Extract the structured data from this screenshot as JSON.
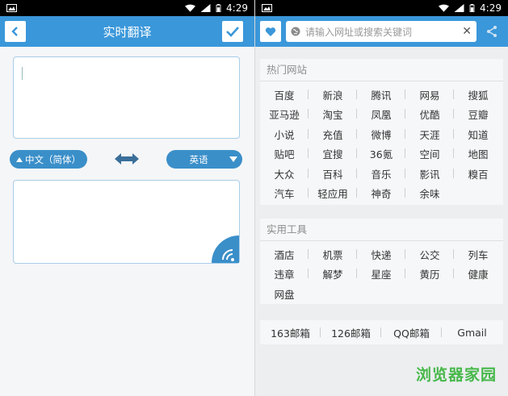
{
  "status_bar": {
    "time": "4:29"
  },
  "left": {
    "header": {
      "title": "实时翻译"
    },
    "source_lang": "中文（简体）",
    "target_lang": "英语",
    "input_value": "",
    "output_value": ""
  },
  "right": {
    "search": {
      "placeholder": "请输入网址或搜索关键词"
    },
    "hot_sites": {
      "title": "热门网站",
      "rows": [
        [
          "百度",
          "新浪",
          "腾讯",
          "网易",
          "搜狐"
        ],
        [
          "亚马逊",
          "淘宝",
          "凤凰",
          "优酷",
          "豆瓣"
        ],
        [
          "小说",
          "充值",
          "微博",
          "天涯",
          "知道"
        ],
        [
          "贴吧",
          "宜搜",
          "36氪",
          "空间",
          "地图"
        ],
        [
          "大众",
          "百科",
          "音乐",
          "影讯",
          "糗百"
        ],
        [
          "汽车",
          "轻应用",
          "神奇",
          "余味"
        ]
      ]
    },
    "tools": {
      "title": "实用工具",
      "rows": [
        [
          "酒店",
          "机票",
          "快递",
          "公交",
          "列车"
        ],
        [
          "违章",
          "解梦",
          "星座",
          "黄历",
          "健康"
        ],
        [
          "网盘"
        ]
      ]
    },
    "mail": [
      "163邮箱",
      "126邮箱",
      "QQ邮箱",
      "Gmail"
    ]
  },
  "watermark": "浏览器家园",
  "colors": {
    "header_blue": "#3a97da",
    "pill_blue": "#3a8fc9",
    "watermark_green": "#47b84a"
  }
}
